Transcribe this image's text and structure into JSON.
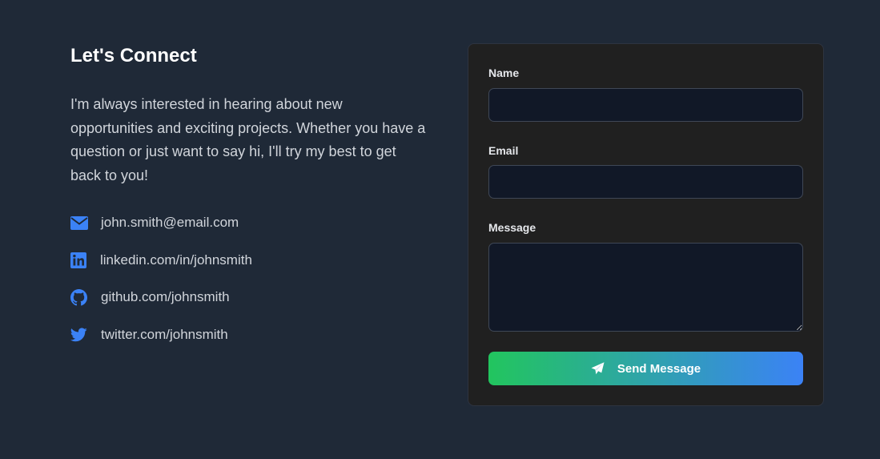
{
  "header": {
    "title": "Let's Connect"
  },
  "intro": {
    "text": "I'm always interested in hearing about new opportunities and exciting projects. Whether you have a question or just want to say hi, I'll try my best to get back to you!"
  },
  "contacts": [
    {
      "icon": "envelope-icon",
      "label": "john.smith@email.com"
    },
    {
      "icon": "linkedin-icon",
      "label": "linkedin.com/in/johnsmith"
    },
    {
      "icon": "github-icon",
      "label": "github.com/johnsmith"
    },
    {
      "icon": "twitter-icon",
      "label": "twitter.com/johnsmith"
    }
  ],
  "form": {
    "name_label": "Name",
    "name_value": "",
    "email_label": "Email",
    "email_value": "",
    "message_label": "Message",
    "message_value": "",
    "submit_label": "Send Message",
    "submit_icon": "paper-plane-icon"
  },
  "colors": {
    "background": "#1f2937",
    "card": "#202020",
    "input": "#111827",
    "accent_blue": "#3b82f6",
    "gradient_start": "#22c55e",
    "gradient_end": "#3b82f6"
  }
}
